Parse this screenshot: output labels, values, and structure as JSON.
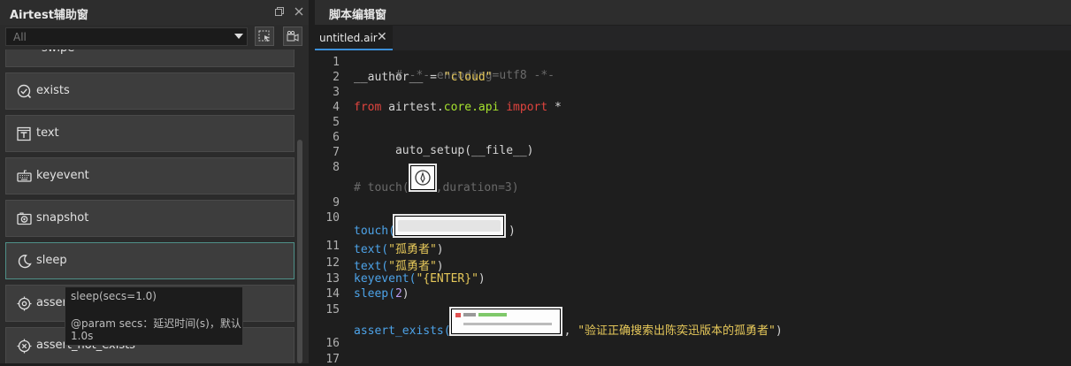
{
  "left_panel": {
    "title": "Airtest辅助窗",
    "filter_value": "All",
    "partial_item": "swipe",
    "commands": [
      {
        "label": "exists",
        "icon": "check-circle-icon"
      },
      {
        "label": "text",
        "icon": "text-box-icon"
      },
      {
        "label": "keyevent",
        "icon": "keyboard-icon"
      },
      {
        "label": "snapshot",
        "icon": "camera-icon"
      },
      {
        "label": "sleep",
        "icon": "moon-icon"
      },
      {
        "label": "assert_exists",
        "icon": "target-icon"
      },
      {
        "label": "assert_not_exists",
        "icon": "target-x-icon"
      }
    ],
    "tooltip": {
      "signature": "sleep(secs=1.0)",
      "param_line1": "@param secs：延迟时间(s)，默认",
      "param_line2": "1.0s"
    }
  },
  "right_panel": {
    "title": "脚本编辑窗",
    "tab_name": "untitled.air",
    "line_numbers": [
      "1",
      "2",
      "3",
      "4",
      "5",
      "6",
      "7",
      "8",
      "9",
      "10",
      "11",
      "12",
      "13",
      "14",
      "15",
      "16",
      "17"
    ],
    "code": {
      "l1": "# -*- encoding=utf8 -*-",
      "l2_a": "__author__",
      "l2_b": " = ",
      "l2_c": "\"cloud\"",
      "l4_a": "from",
      "l4_b": " airtest.",
      "l4_c": "core.api",
      "l4_d": " import",
      "l4_e": " *",
      "l6": "auto_setup(__file__)",
      "l8_a": "# touch(",
      "l8_b": ",duration=3)",
      "l10_a": "touch(",
      "l10_b": ")",
      "l11_a": "text(",
      "l11_b": "\"孤勇者\"",
      "l11_c": ")",
      "l12_a": "text(",
      "l12_b": "\"孤勇者\"",
      "l12_c": ")",
      "l13_a": "keyevent(",
      "l13_b": "\"{ENTER}\"",
      "l13_c": ")",
      "l14_a": "sleep(",
      "l14_b": "2",
      "l14_c": ")",
      "l15_a": "assert_exists(",
      "l15_b": ", ",
      "l15_c": "\"验证正确搜索出陈奕迅版本的孤勇者\"",
      "l15_d": ")"
    }
  },
  "colors": {
    "accent_tab": "#3c8fd8",
    "string": "#e6c85a",
    "keyword": "#e0443e",
    "module": "#a6e22e",
    "number": "#b99bf0",
    "comment": "#6a6a6a"
  }
}
